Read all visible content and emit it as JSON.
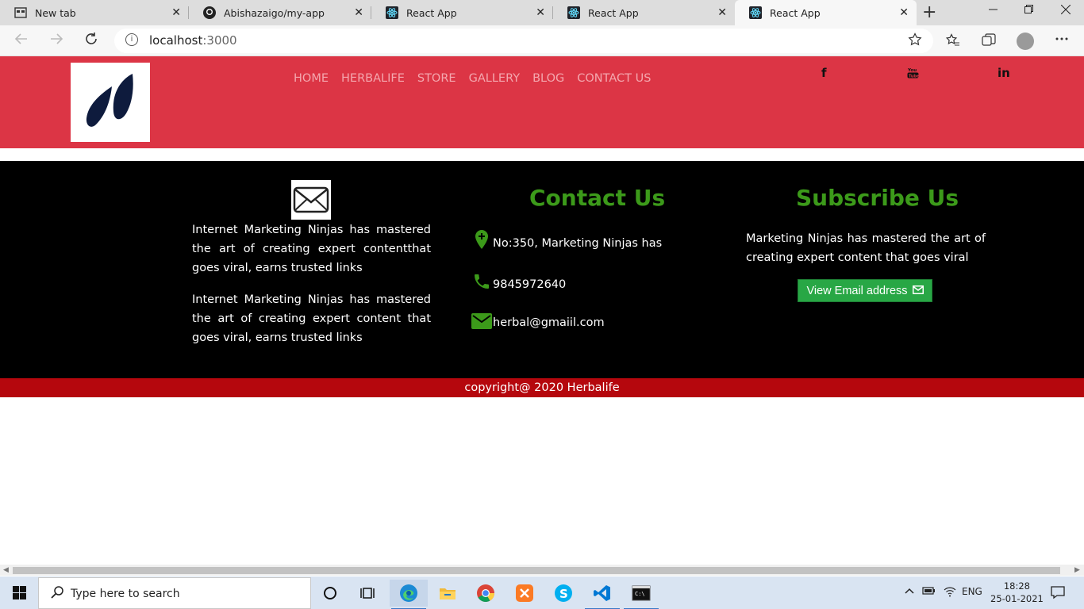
{
  "browser": {
    "tabs": [
      {
        "title": "New tab",
        "icon": "new-tab-page-icon",
        "active": false
      },
      {
        "title": "Abishazaigo/my-app",
        "icon": "github-icon",
        "active": false
      },
      {
        "title": "React App",
        "icon": "react-icon",
        "active": false
      },
      {
        "title": "React App",
        "icon": "react-icon",
        "active": false
      },
      {
        "title": "React App",
        "icon": "react-icon",
        "active": true
      }
    ],
    "close_glyph": "✕",
    "new_tab_glyph": "+",
    "url_host": "localhost",
    "url_port": ":3000"
  },
  "header": {
    "background": "#dc3545",
    "nav": [
      "HOME",
      "HERBALIFE",
      "STORE",
      "GALLERY",
      "BLOG",
      "CONTACT US"
    ],
    "social": {
      "facebook": "f",
      "youtube": "▶",
      "linkedin": "in"
    }
  },
  "footer": {
    "about": [
      "Internet Marketing Ninjas has mastered the art of creating expert contentthat goes viral, earns trusted links",
      "Internet Marketing Ninjas has mastered the art of creating expert content that goes viral, earns trusted links"
    ],
    "contact": {
      "title": "Contact Us",
      "address": "No:350, Marketing Ninjas has",
      "phone": "9845972640",
      "email": "herbal@gmaiil.com"
    },
    "subscribe": {
      "title": "Subscribe Us",
      "text": "Marketing Ninjas has mastered the art of creating expert content that goes viral",
      "button": "View Email address"
    },
    "accent": "#3c9a1a"
  },
  "copyright": "copyright@ 2020 Herbalife",
  "taskbar": {
    "search_placeholder": "Type here to search",
    "language": "ENG",
    "time": "18:28",
    "date": "25-01-2021"
  }
}
